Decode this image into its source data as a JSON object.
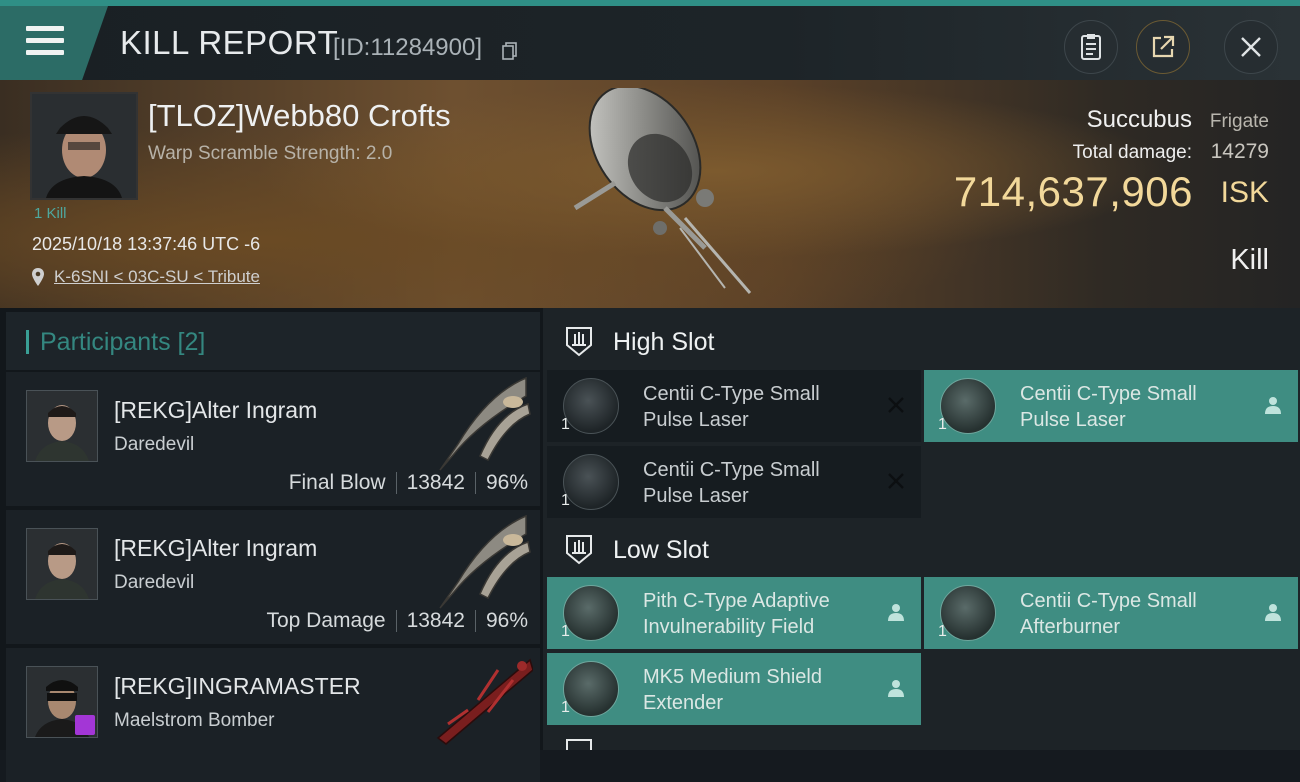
{
  "header": {
    "title": "KILL REPORT",
    "report_id": "[ID:11284900]",
    "icons": [
      "menu-icon",
      "copy-icon",
      "clipboard-icon",
      "share-icon",
      "close-icon"
    ]
  },
  "victim": {
    "name": "[TLOZ]Webb80 Crofts",
    "subtitle": "Warp Scramble Strength: 2.0",
    "kill_count": "1 Kill",
    "datetime": "2025/10/18 13:37:46 UTC -6",
    "location": "K-6SNI < 03C-SU < Tribute",
    "ship_name": "Succubus",
    "ship_class": "Frigate",
    "damage_label": "Total damage:",
    "damage_value": "14279",
    "isk_value": "714,637,906",
    "isk_unit": "ISK",
    "result": "Kill"
  },
  "participants": {
    "title": "Participants [2]",
    "rows": [
      {
        "name": "[REKG]Alter Ingram",
        "ship": "Daredevil",
        "tag": "Final Blow",
        "damage": "13842",
        "percent": "96%"
      },
      {
        "name": "[REKG]Alter Ingram",
        "ship": "Daredevil",
        "tag": "Top Damage",
        "damage": "13842",
        "percent": "96%"
      },
      {
        "name": "[REKG]INGRAMASTER",
        "ship": "Maelstrom Bomber",
        "tag": "",
        "damage": "",
        "percent": ""
      }
    ]
  },
  "slots": {
    "high": {
      "title": "High Slot",
      "modules": [
        {
          "line1": "Centii C-Type Small",
          "line2": "Pulse Laser",
          "qty": "1",
          "status": "destroyed"
        },
        {
          "line1": "Centii C-Type Small",
          "line2": "Pulse Laser",
          "qty": "1",
          "status": "dropped"
        },
        {
          "line1": "Centii C-Type Small",
          "line2": "Pulse Laser",
          "qty": "1",
          "status": "destroyed"
        }
      ]
    },
    "low": {
      "title": "Low Slot",
      "modules": [
        {
          "line1": "Pith C-Type Adaptive",
          "line2": "Invulnerability Field",
          "qty": "1",
          "status": "dropped"
        },
        {
          "line1": "Centii C-Type Small",
          "line2": "Afterburner",
          "qty": "1",
          "status": "dropped"
        },
        {
          "line1": "MK5 Medium Shield",
          "line2": "Extender",
          "qty": "1",
          "status": "dropped"
        }
      ]
    }
  },
  "colors": {
    "accent": "#3aa096",
    "isk": "#f2d89a",
    "active_module": "#3f8d82"
  }
}
